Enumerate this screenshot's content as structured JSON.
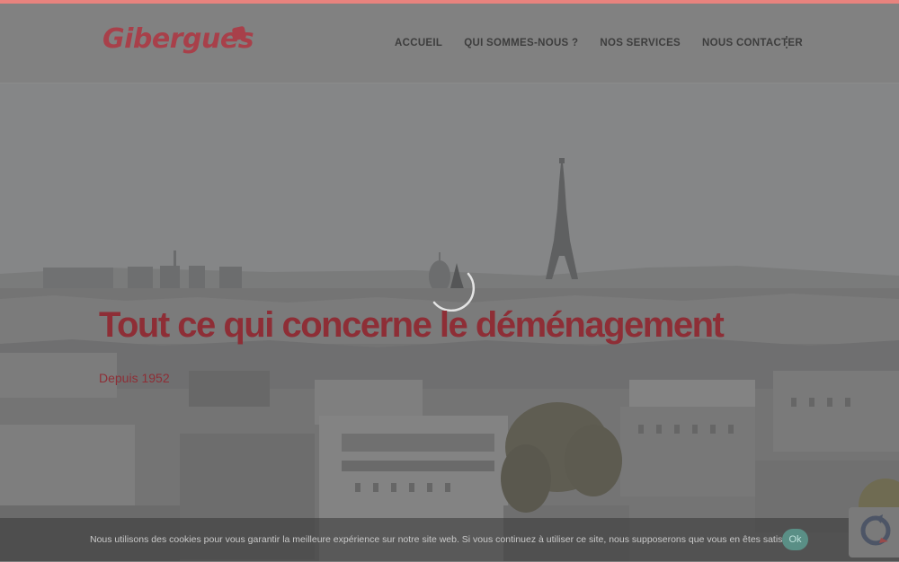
{
  "header": {
    "logo_text": "Gibergues",
    "nav": [
      {
        "label": "ACCUEIL"
      },
      {
        "label": "QUI SOMMES-NOUS ?"
      },
      {
        "label": "NOS SERVICES"
      },
      {
        "label": "NOUS CONTACTER"
      }
    ],
    "more_icon": "vertical-ellipsis-icon"
  },
  "hero": {
    "title": "Tout ce qui concerne le déménagement",
    "subtitle": "Depuis 1952"
  },
  "cookie": {
    "message": "Nous utilisons des cookies pour vous garantir la meilleure expérience sur notre site web. Si vous continuez à utiliser ce site, nous supposerons que vous en êtes satisfait.",
    "ok_label": "Ok"
  },
  "colors": {
    "accent": "#e8837e",
    "brand": "#a8404a",
    "overlay": "#7d7d7d"
  }
}
